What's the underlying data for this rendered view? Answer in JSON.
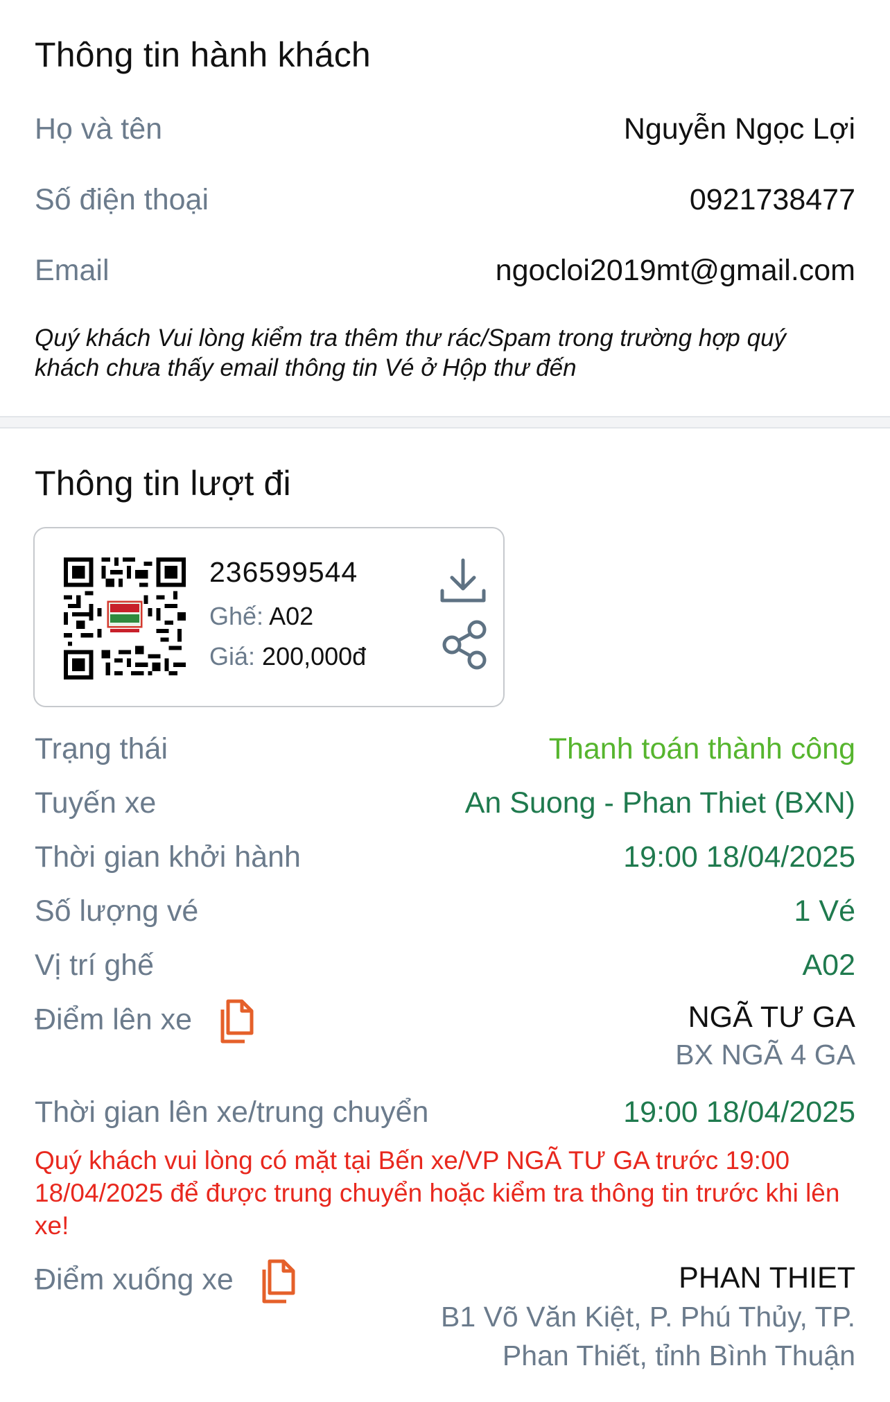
{
  "passenger": {
    "title": "Thông tin hành khách",
    "name_label": "Họ và tên",
    "name_value": "Nguyễn Ngọc Lợi",
    "phone_label": "Số điện thoại",
    "phone_value": "0921738477",
    "email_label": "Email",
    "email_value": "ngocloi2019mt@gmail.com",
    "note": "Quý khách Vui lòng kiểm tra thêm thư rác/Spam trong trường hợp quý khách chưa thấy email thông tin Vé ở Hộp thư đến"
  },
  "trip": {
    "title": "Thông tin lượt đi",
    "ticket": {
      "code": "236599544",
      "seat_label": "Ghế:",
      "seat_value": "A02",
      "price_label": "Giá:",
      "price_value": "200,000đ"
    },
    "status_label": "Trạng thái",
    "status_value": "Thanh toán thành công",
    "route_label": "Tuyến xe",
    "route_value": "An Suong - Phan Thiet (BXN)",
    "departure_label": "Thời gian khởi hành",
    "departure_value": "19:00 18/04/2025",
    "quantity_label": "Số lượng vé",
    "quantity_value": "1 Vé",
    "seat_label": "Vị trí ghế",
    "seat_value": "A02",
    "pickup_label": "Điểm lên xe",
    "pickup_value": "NGÃ TƯ GA",
    "pickup_sub": "BX NGÃ 4 GA",
    "board_time_label": "Thời gian lên xe/trung chuyển",
    "board_time_value": "19:00 18/04/2025",
    "warning": "Quý khách vui lòng có mặt tại Bến xe/VP NGÃ TƯ GA trước 19:00 18/04/2025 để được trung chuyển hoặc kiểm tra thông tin trước khi lên xe!",
    "dropoff_label": "Điểm xuống xe",
    "dropoff_value": "PHAN THIET",
    "dropoff_sub_1": "B1 Võ Văn Kiệt, P. Phú Thủy, TP.",
    "dropoff_sub_2": "Phan Thiết, tỉnh Bình Thuận"
  },
  "colors": {
    "label": "#6b7b8c",
    "success": "#56b52e",
    "highlight": "#1f7a4e",
    "warning": "#e8281e",
    "copy_icon": "#e5602a"
  },
  "icons": [
    "qr-code-icon",
    "download-icon",
    "share-icon",
    "copy-icon"
  ]
}
